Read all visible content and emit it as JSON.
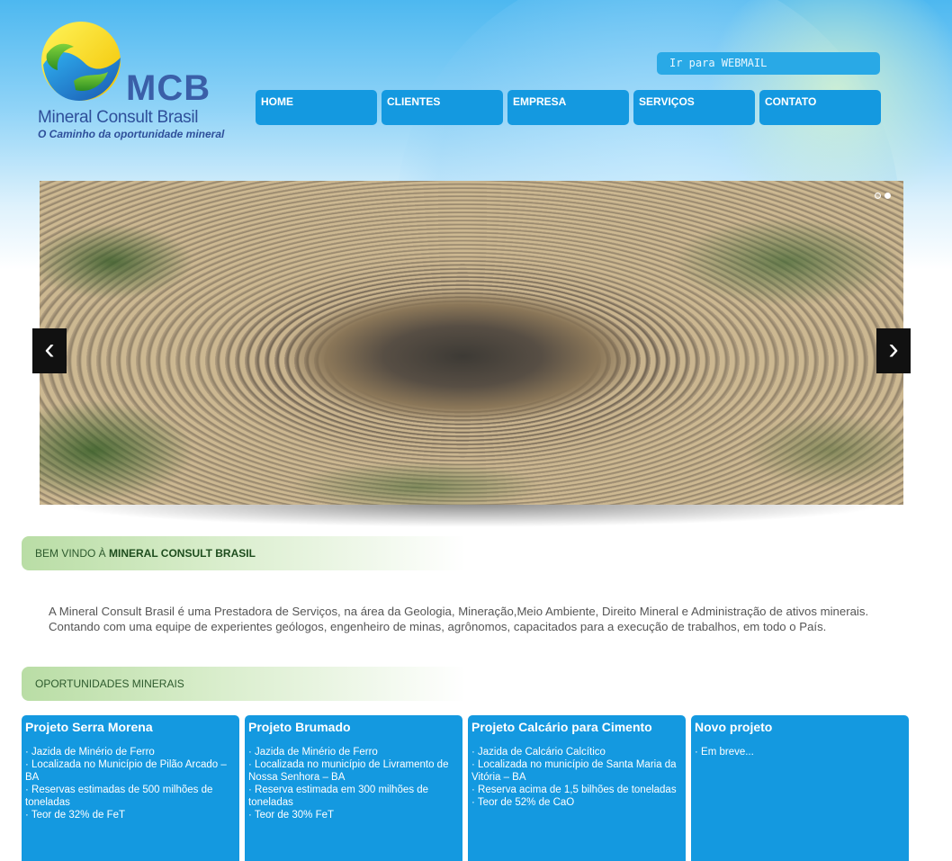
{
  "logo": {
    "abbr": "MCB",
    "name": "Mineral Consult Brasil",
    "tagline": "O Caminho da oportunidade mineral"
  },
  "webmail_label": "Ir para WEBMAIL",
  "nav": {
    "items": [
      "HOME",
      "CLIENTES",
      "EMPRESA",
      "SERVIÇOS",
      "CONTATO"
    ]
  },
  "slider": {
    "prev": "‹",
    "next": "›",
    "slide_count": 2,
    "active_slide": 2
  },
  "welcome": {
    "prefix": "BEM VINDO À ",
    "brand": "MINERAL CONSULT BRASIL"
  },
  "intro_text": "A Mineral Consult Brasil é uma Prestadora de Serviços, na área da Geologia, Mineração,Meio Ambiente, Direito Mineral e Administração de ativos minerais. Contando com uma equipe de experientes geólogos, engenheiro de minas, agrônomos, capacitados para a execução de trabalhos, em todo o País.",
  "opportunities": {
    "heading": "OPORTUNIDADES MINERAIS",
    "cards": [
      {
        "title": "Projeto Serra Morena",
        "items": [
          "· Jazida de Minério de Ferro",
          "· Localizada no Município de Pilão Arcado – BA",
          "· Reservas estimadas de 500 milhões de toneladas",
          "· Teor de 32% de FeT"
        ]
      },
      {
        "title": "Projeto Brumado",
        "items": [
          "· Jazida de Minério de Ferro",
          "· Localizada no município de Livramento de Nossa Senhora – BA",
          "· Reserva estimada em 300 milhões de toneladas",
          "· Teor de 30% FeT"
        ]
      },
      {
        "title": "Projeto Calcário para Cimento",
        "items": [
          "· Jazida de Calcário Calcítico",
          "· Localizada no município de Santa Maria da Vitória – BA",
          "· Reserva acima de 1,5 bilhões de toneladas",
          "· Teor de 52% de CaO"
        ]
      },
      {
        "title": "Novo projeto",
        "items": [
          "· Em breve..."
        ]
      }
    ]
  },
  "colors": {
    "nav_blue": "#1499e0",
    "logo_blue": "#3a5fa8",
    "header_green": "#b9dda5"
  }
}
